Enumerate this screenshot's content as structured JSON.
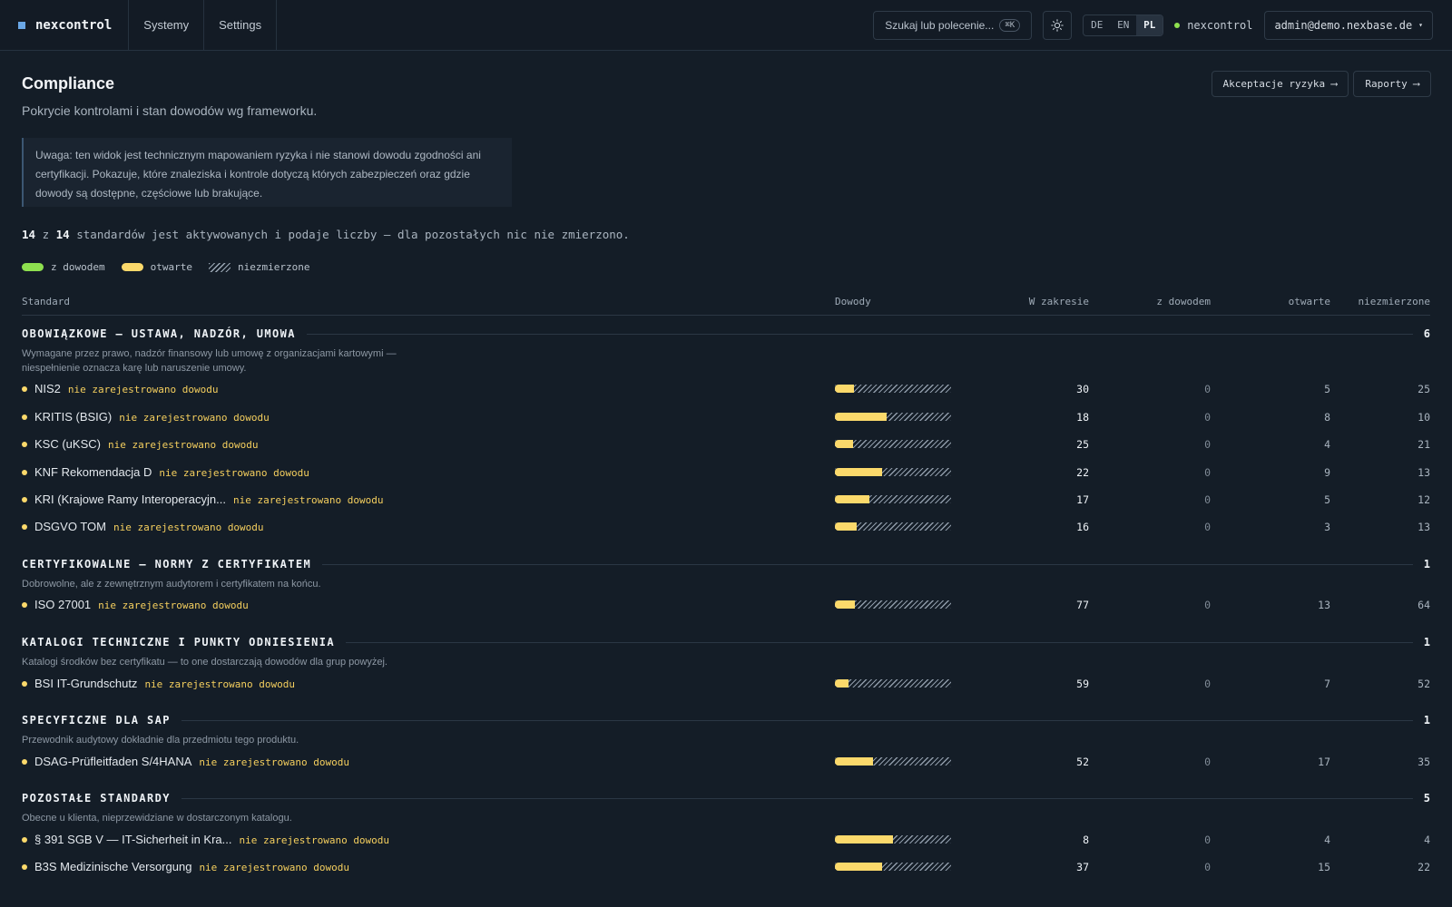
{
  "topbar": {
    "brand": "nexcontrol",
    "nav": [
      "Systemy",
      "Settings"
    ],
    "search_placeholder": "Szukaj lub polecenie...",
    "search_shortcut": "⌘K",
    "theme_icon": "sun-icon",
    "languages": [
      "DE",
      "EN",
      "PL"
    ],
    "active_language": "PL",
    "tenant": "nexcontrol",
    "tenant_status_color": "#8ee04f",
    "user": "admin@demo.nexbase.de",
    "user_caret": "▾"
  },
  "page": {
    "title": "Compliance",
    "subtitle": "Pokrycie kontrolami i stan dowodów wg frameworku.",
    "actions": [
      "Akceptacje ryzyka ⟶",
      "Raporty ⟶"
    ],
    "notice": "Uwaga: ten widok jest technicznym mapowaniem ryzyka i nie stanowi dowodu zgodności ani certyfikacji. Pokazuje, które znaleziska i kontrole dotyczą których zabezpieczeń oraz gdzie dowody są dostępne, częściowe lub brakujące.",
    "summary": {
      "active": "14",
      "connector": "z",
      "total": "14",
      "text": "standardów jest aktywowanych i podaje liczby — dla pozostałych nic nie zmierzono."
    }
  },
  "legend": {
    "evidence": "z dowodem",
    "open": "otwarte",
    "unmeasured": "niezmierzone",
    "colors": {
      "evidence": "#8ee04f",
      "open": "#fbd96b"
    }
  },
  "table": {
    "headers": {
      "standard": "Standard",
      "evidence": "Dowody",
      "in_scope": "W zakresie",
      "with_evidence": "z dowodem",
      "open": "otwarte",
      "unmeasured": "niezmierzone"
    },
    "no_evidence_tag": "nie zarejestrowano dowodu",
    "groups": [
      {
        "title": "OBOWIĄZKOWE — USTAWA, NADZÓR, UMOWA",
        "count": "6",
        "desc": "Wymagane przez prawo, nadzór finansowy lub umowę z organizacjami kartowymi — niespełnienie oznacza karę lub naruszenie umowy.",
        "rows": [
          {
            "name": "NIS2",
            "in_scope": "30",
            "evidence": "0",
            "open": "5",
            "unmeasured": "25"
          },
          {
            "name": "KRITIS (BSIG)",
            "in_scope": "18",
            "evidence": "0",
            "open": "8",
            "unmeasured": "10"
          },
          {
            "name": "KSC (uKSC)",
            "in_scope": "25",
            "evidence": "0",
            "open": "4",
            "unmeasured": "21"
          },
          {
            "name": "KNF Rekomendacja D",
            "in_scope": "22",
            "evidence": "0",
            "open": "9",
            "unmeasured": "13"
          },
          {
            "name": "KRI (Krajowe Ramy Interoperacyjn...",
            "in_scope": "17",
            "evidence": "0",
            "open": "5",
            "unmeasured": "12"
          },
          {
            "name": "DSGVO TOM",
            "in_scope": "16",
            "evidence": "0",
            "open": "3",
            "unmeasured": "13"
          }
        ]
      },
      {
        "title": "CERTYFIKOWALNE — NORMY Z CERTYFIKATEM",
        "count": "1",
        "desc": "Dobrowolne, ale z zewnętrznym audytorem i certyfikatem na końcu.",
        "rows": [
          {
            "name": "ISO 27001",
            "in_scope": "77",
            "evidence": "0",
            "open": "13",
            "unmeasured": "64"
          }
        ]
      },
      {
        "title": "KATALOGI TECHNICZNE I PUNKTY ODNIESIENIA",
        "count": "1",
        "desc": "Katalogi środków bez certyfikatu — to one dostarczają dowodów dla grup powyżej.",
        "rows": [
          {
            "name": "BSI IT-Grundschutz",
            "in_scope": "59",
            "evidence": "0",
            "open": "7",
            "unmeasured": "52"
          }
        ]
      },
      {
        "title": "SPECYFICZNE DLA SAP",
        "count": "1",
        "desc": "Przewodnik audytowy dokładnie dla przedmiotu tego produktu.",
        "rows": [
          {
            "name": "DSAG-Prüfleitfaden S/4HANA",
            "in_scope": "52",
            "evidence": "0",
            "open": "17",
            "unmeasured": "35"
          }
        ]
      },
      {
        "title": "POZOSTAŁE STANDARDY",
        "count": "5",
        "desc": "Obecne u klienta, nieprzewidziane w dostarczonym katalogu.",
        "rows": [
          {
            "name": "§ 391 SGB V — IT-Sicherheit in Kra...",
            "in_scope": "8",
            "evidence": "0",
            "open": "4",
            "unmeasured": "4"
          },
          {
            "name": "B3S Medizinische Versorgung",
            "in_scope": "37",
            "evidence": "0",
            "open": "15",
            "unmeasured": "22"
          }
        ]
      }
    ]
  }
}
